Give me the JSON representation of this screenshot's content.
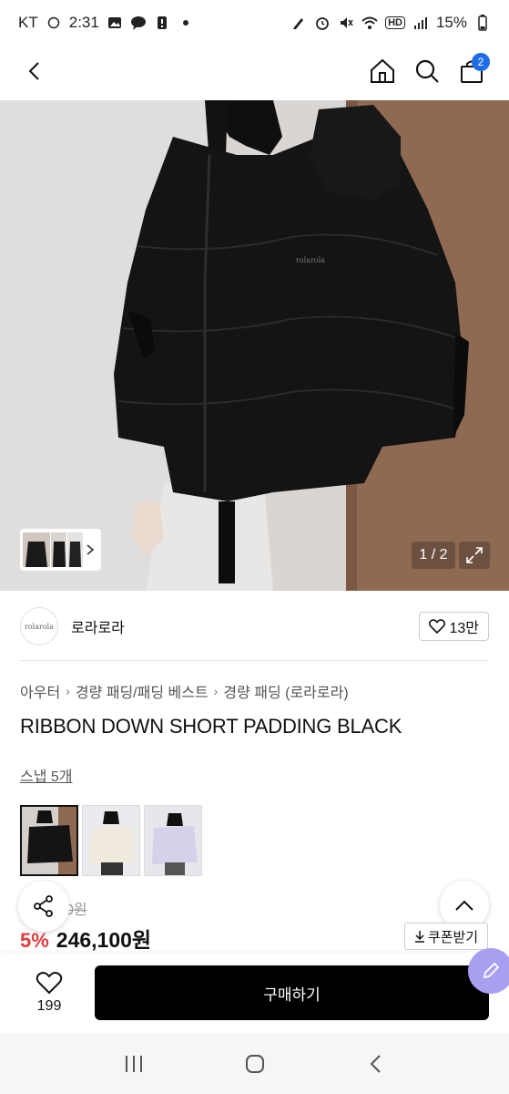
{
  "status_bar": {
    "carrier": "KT",
    "time": "2:31",
    "battery": "15%",
    "hd_label": "HD"
  },
  "nav": {
    "cart_count": "2"
  },
  "hero": {
    "page_indicator": "1 / 2",
    "brand_watermark": "rolarola"
  },
  "brand": {
    "logo_text": "rolarola",
    "name": "로라로라",
    "like_count": "13만"
  },
  "breadcrumb": [
    "아우터",
    "경량 패딩/패딩 베스트",
    "경량 패딩 (로라로라)"
  ],
  "product": {
    "title": "RIBBON DOWN SHORT PADDING BLACK",
    "snap_link": "스냅 5개",
    "original_price": "0원",
    "discount": "5%",
    "price": "246,100원",
    "coupon_label": "쿠폰받기"
  },
  "color_options": [
    {
      "name": "black",
      "selected": true
    },
    {
      "name": "cream",
      "selected": false
    },
    {
      "name": "lavender",
      "selected": false
    }
  ],
  "purchase": {
    "wish_count": "199",
    "buy_label": "구매하기"
  },
  "colors": {
    "accent_blue": "#1e6de6",
    "discount_red": "#e23b3b",
    "buy_button": "#000000",
    "fab_purple": "#a99ff0"
  }
}
